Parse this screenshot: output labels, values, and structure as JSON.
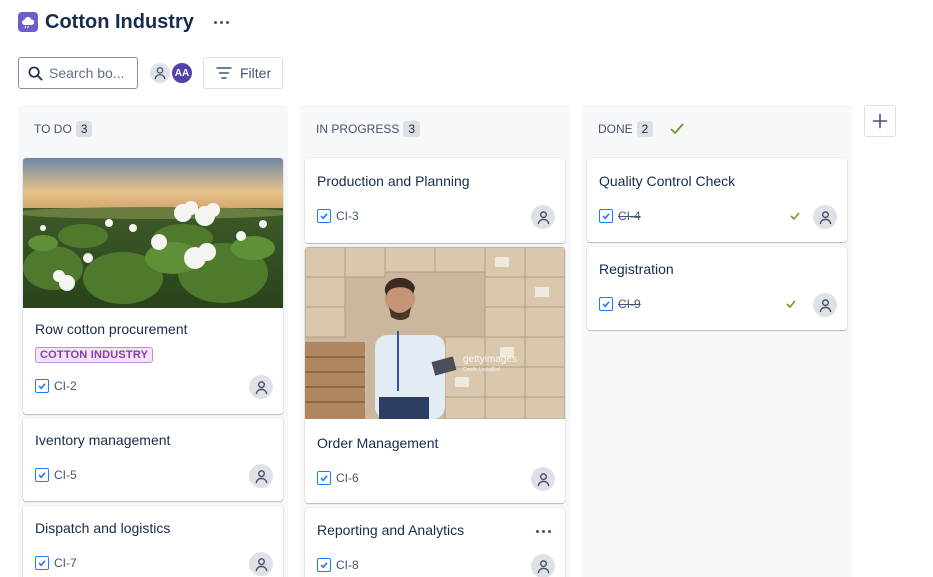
{
  "project": {
    "title": "Cotton Industry",
    "icon": "cloud-icon"
  },
  "toolbar": {
    "search_placeholder": "Search bo...",
    "avatar_initials": "AA",
    "filter_label": "Filter"
  },
  "columns": [
    {
      "name": "TO DO",
      "count": "3",
      "cards": [
        {
          "title": "Row cotton procurement",
          "label": "COTTON INDUSTRY",
          "key": "CI-2",
          "image": "cotton-field-photo"
        },
        {
          "title": "Iventory management",
          "key": "CI-5"
        },
        {
          "title": "Dispatch and logistics",
          "key": "CI-7"
        }
      ]
    },
    {
      "name": "IN PROGRESS",
      "count": "3",
      "cards": [
        {
          "title": "Production and Planning",
          "key": "CI-3"
        },
        {
          "title": "Order Management",
          "key": "CI-6",
          "image": "warehouse-photo"
        },
        {
          "title": "Reporting and Analytics",
          "key": "CI-8"
        }
      ]
    },
    {
      "name": "DONE",
      "count": "2",
      "cards": [
        {
          "title": "Quality Control Check",
          "key": "CI-4",
          "done": true
        },
        {
          "title": "Registration",
          "key": "CI-9",
          "done": true
        }
      ]
    }
  ],
  "watermark": {
    "brand": "gettyimages",
    "credit": "Credit: LeylaBird"
  },
  "colors": {
    "accent": "#1d7afc",
    "done_green": "#6a9a23",
    "project_icon": "#6e5dc6",
    "label_purple": "#8a3ba9"
  }
}
